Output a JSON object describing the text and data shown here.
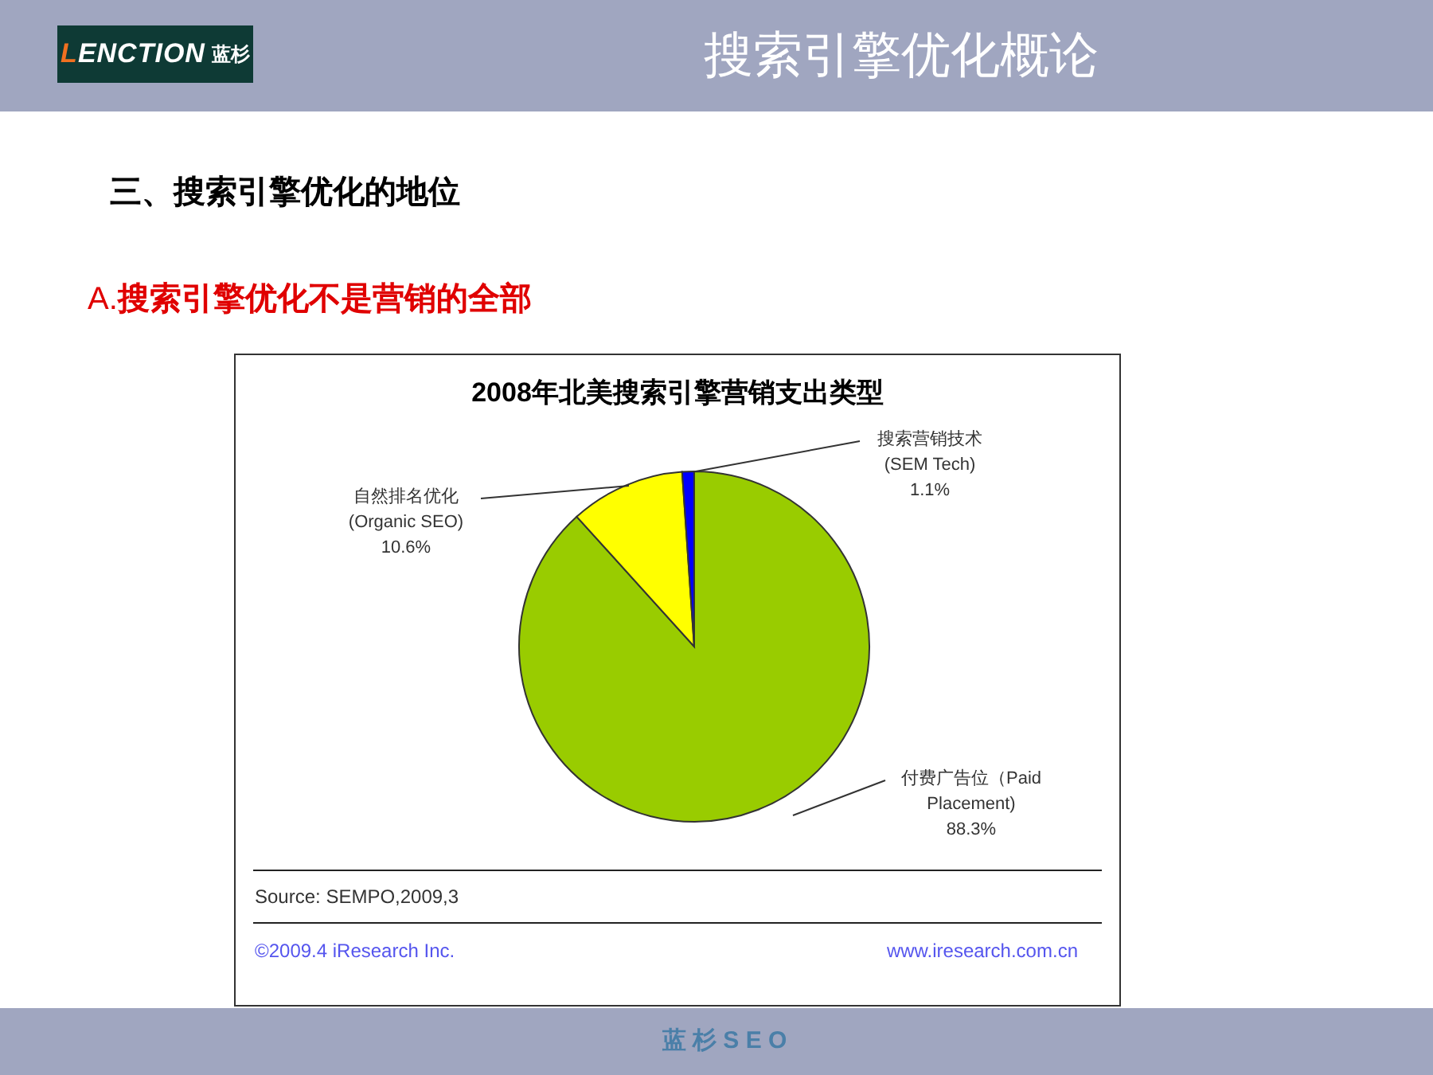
{
  "header": {
    "logo": {
      "initial": "L",
      "rest": "ENCTION",
      "cn": "蓝杉"
    },
    "title": "搜索引擎优化概论"
  },
  "section_heading": "三、搜索引擎优化的地位",
  "subheading": {
    "marker": "A.",
    "text": "搜索引擎优化不是营销的全部"
  },
  "chart": {
    "chart_data": {
      "type": "pie",
      "title": "2008年北美搜索引擎营销支出类型",
      "categories": [
        "付费广告位（Paid Placement)",
        "自然排名优化 (Organic SEO)",
        "搜索营销技术 (SEM Tech)"
      ],
      "series": [
        {
          "values": [
            88.3,
            10.6,
            1.1
          ]
        }
      ],
      "colors": [
        "#99cc00",
        "#ffff00",
        "#0000ff"
      ],
      "value_labels": [
        "88.3%",
        "10.6%",
        "1.1%"
      ]
    },
    "source": "Source:  SEMPO,2009,3",
    "copyright": "©2009.4  iResearch Inc.",
    "website": "www.iresearch.com.cn"
  },
  "footer": "蓝 杉 S E O"
}
